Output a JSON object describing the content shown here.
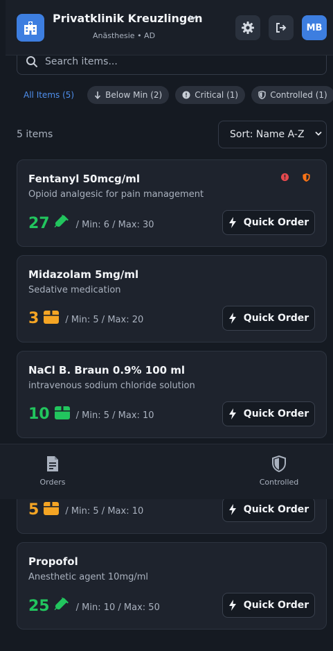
{
  "header": {
    "clinic_name": "Privatklinik Kreuzlingen",
    "department": "Anästhesie • AD",
    "avatar_initials": "MB",
    "icons": {
      "app": "hospital-icon",
      "settings": "gear-icon",
      "logout": "logout-icon",
      "chevron": "chevron-down-icon"
    }
  },
  "search": {
    "placeholder": "Search items..."
  },
  "filters": [
    {
      "label": "All Items (5)",
      "active": true
    },
    {
      "label": "Below Min (2)",
      "icon": "arrow-down-icon"
    },
    {
      "label": "Critical (1)",
      "icon": "alert-circle-icon"
    },
    {
      "label": "Controlled (1)",
      "icon": "shield-icon"
    }
  ],
  "list": {
    "count_label": "5 items",
    "sort_label": "Sort: Name A-Z"
  },
  "items": [
    {
      "name": "Fentanyl 50mcg/ml",
      "desc": "Opioid analgesic for pain management",
      "qty": "27",
      "minmax": "/ Min: 6 / Max: 30",
      "status_color": "#22c55e",
      "unit_icon": "syringe-icon",
      "badges": [
        "critical-icon",
        "controlled-shield-icon"
      ],
      "order_label": "Quick Order"
    },
    {
      "name": "Midazolam 5mg/ml",
      "desc": "Sedative medication",
      "qty": "3",
      "minmax": "/ Min: 5 / Max: 20",
      "status_color": "#f5a524",
      "unit_icon": "box-icon",
      "order_label": "Quick Order"
    },
    {
      "name": "NaCl B. Braun 0.9% 100 ml",
      "desc": "intravenous sodium chloride solution",
      "qty": "10",
      "minmax": "/ Min: 5 / Max: 10",
      "status_color": "#22c55e",
      "unit_icon": "box-icon",
      "order_label": "Quick Order"
    },
    {
      "name": "",
      "desc": "",
      "qty": "5",
      "minmax": "/ Min: 5 / Max: 10",
      "status_color": "#f5a524",
      "unit_icon": "box-icon",
      "order_label": "Quick Order"
    },
    {
      "name": "Propofol",
      "desc": "Anesthetic agent 10mg/ml",
      "qty": "25",
      "minmax": "/ Min: 10 / Max: 50",
      "status_color": "#22c55e",
      "unit_icon": "syringe-icon",
      "order_label": "Quick Order"
    }
  ],
  "bottom_nav": [
    {
      "label": "Orders",
      "icon": "document-icon"
    },
    {
      "label": "Controlled",
      "icon": "shield-icon"
    }
  ]
}
